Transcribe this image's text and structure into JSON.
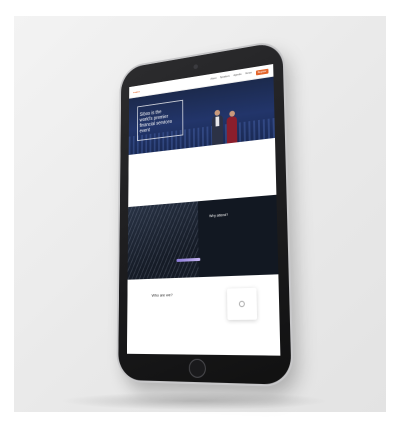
{
  "site": {
    "nav": {
      "logo": "•••••",
      "links": [
        "About",
        "Speakers",
        "Agenda",
        "Venue",
        "Register"
      ]
    },
    "hero": {
      "kicker": "",
      "title": "Sibos is the\nworld's premier\nfinancial services\nevent"
    },
    "intro": {
      "lead": "",
      "body": ""
    },
    "dark_section": {
      "image_label": "",
      "heading": "Why attend?",
      "paragraphs": [
        "",
        ""
      ]
    },
    "who_section": {
      "heading": "Who are we?",
      "body": ""
    }
  },
  "colors": {
    "accent": "#e3642a",
    "hero_bg": "#1c2a4d",
    "dark_bg": "#121822"
  }
}
